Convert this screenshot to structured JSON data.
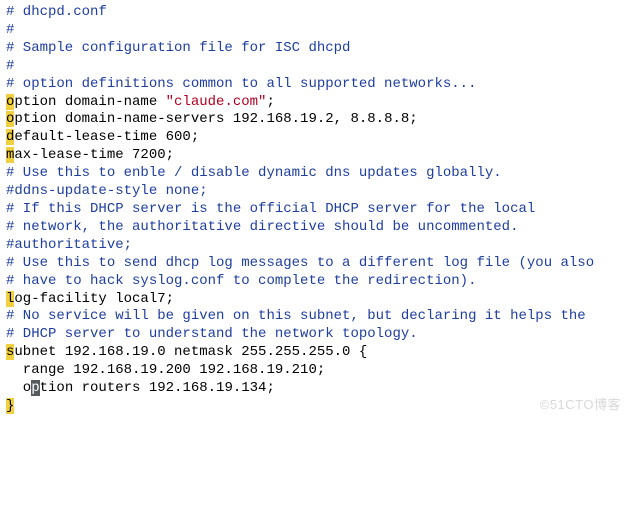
{
  "lines": {
    "l1": "# dhcpd.conf",
    "l2": "#",
    "l3": "# Sample configuration file for ISC dhcpd",
    "l4": "#",
    "l5": "",
    "l6": "# option definitions common to all supported networks...",
    "l7a": "o",
    "l7b": "ption domain-name ",
    "l7c": "\"claude.com\"",
    "l7d": ";",
    "l8a": "o",
    "l8b": "ption domain-name-servers 192.168.19.2, 8.8.8.8;",
    "l9": "",
    "l10a": "d",
    "l10b": "efault-lease-time 600;",
    "l11a": "m",
    "l11b": "ax-lease-time 7200;",
    "l12": "",
    "l13": "# Use this to enble / disable dynamic dns updates globally.",
    "l14": "#ddns-update-style none;",
    "l15": "",
    "l16": "# If this DHCP server is the official DHCP server for the local",
    "l17": "# network, the authoritative directive should be uncommented.",
    "l18": "#authoritative;",
    "l19": "",
    "l20": "# Use this to send dhcp log messages to a different log file (you also",
    "l21": "# have to hack syslog.conf to complete the redirection).",
    "l22a": "l",
    "l22b": "og-facility local7;",
    "l23": "",
    "l24": "# No service will be given on this subnet, but declaring it helps the",
    "l25": "# DHCP server to understand the network topology.",
    "l26": "",
    "l27a": "s",
    "l27b": "ubnet 192.168.19.0 netmask 255.255.255.0 {",
    "l28": "  range 192.168.19.200 192.168.19.210;",
    "l29a": "  o",
    "l29b": "p",
    "l29c": "tion routers 192.168.19.134;",
    "l30": "}"
  },
  "watermark": "©51CTO博客"
}
